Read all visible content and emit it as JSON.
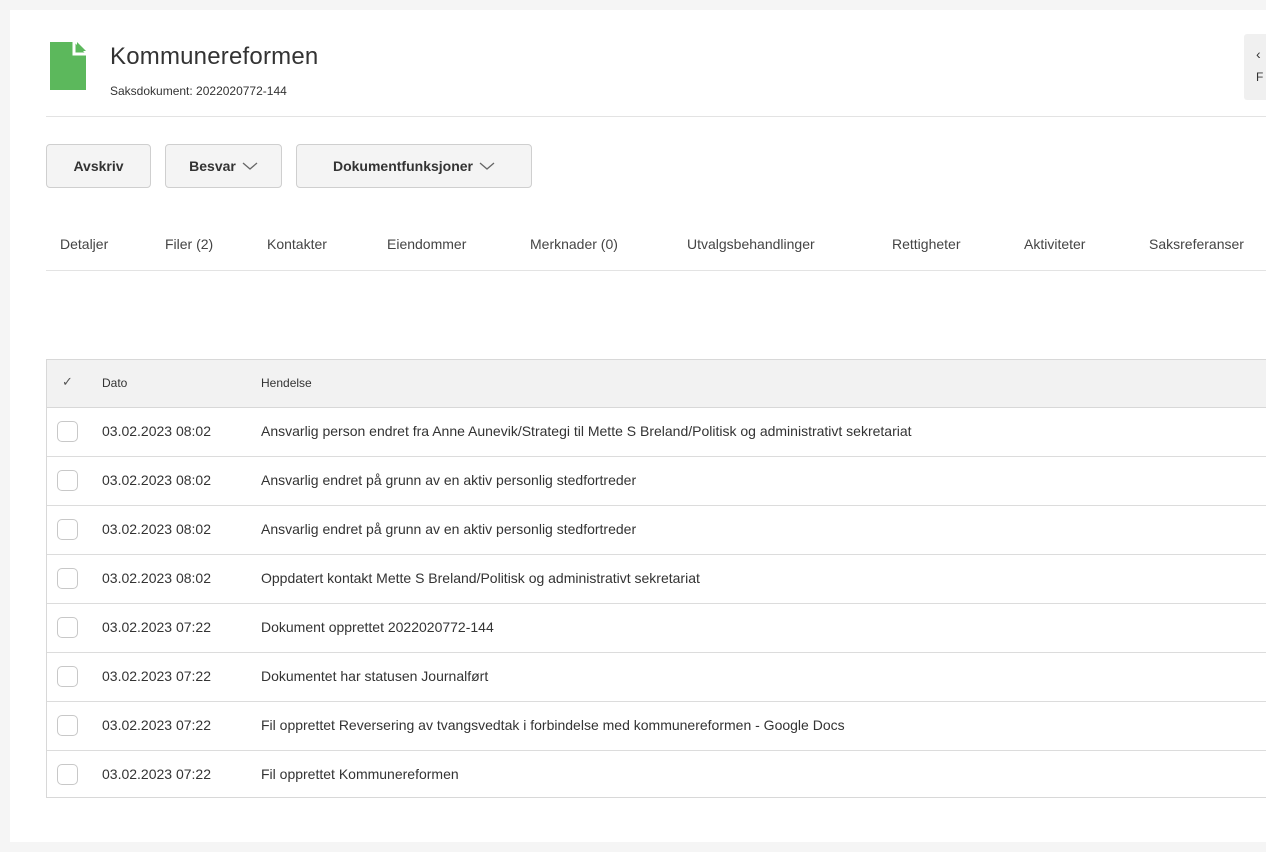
{
  "header": {
    "title": "Kommunereformen",
    "subtitle": "Saksdokument: 2022020772-144",
    "corner_button_label": "F",
    "doc_icon_color": "#5cb85c"
  },
  "toolbar": {
    "avskriv_label": "Avskriv",
    "besvar_label": "Besvar",
    "dokumentfunksjoner_label": "Dokumentfunksjoner"
  },
  "tabs": [
    {
      "label": "Detaljer"
    },
    {
      "label": "Filer (2)"
    },
    {
      "label": "Kontakter"
    },
    {
      "label": "Eiendommer"
    },
    {
      "label": "Merknader (0)"
    },
    {
      "label": "Utvalgsbehandlinger"
    },
    {
      "label": "Rettigheter"
    },
    {
      "label": "Aktiviteter"
    },
    {
      "label": "Saksreferanser"
    }
  ],
  "table": {
    "columns": {
      "check": "✓",
      "date": "Dato",
      "event": "Hendelse"
    },
    "rows": [
      {
        "date": "03.02.2023 08:02",
        "event": "Ansvarlig person endret fra Anne Aunevik/Strategi til Mette S Breland/Politisk og administrativt sekretariat"
      },
      {
        "date": "03.02.2023 08:02",
        "event": "Ansvarlig endret på grunn av en aktiv personlig stedfortreder"
      },
      {
        "date": "03.02.2023 08:02",
        "event": "Ansvarlig endret på grunn av en aktiv personlig stedfortreder"
      },
      {
        "date": "03.02.2023 08:02",
        "event": "Oppdatert kontakt Mette S Breland/Politisk og administrativt sekretariat"
      },
      {
        "date": "03.02.2023 07:22",
        "event": "Dokument opprettet 2022020772-144"
      },
      {
        "date": "03.02.2023 07:22",
        "event": "Dokumentet har statusen Journalført"
      },
      {
        "date": "03.02.2023 07:22",
        "event": "Fil opprettet Reversering av tvangsvedtak i forbindelse med kommunereformen - Google Docs"
      },
      {
        "date": "03.02.2023 07:22",
        "event": "Fil opprettet Kommunereformen"
      }
    ]
  }
}
